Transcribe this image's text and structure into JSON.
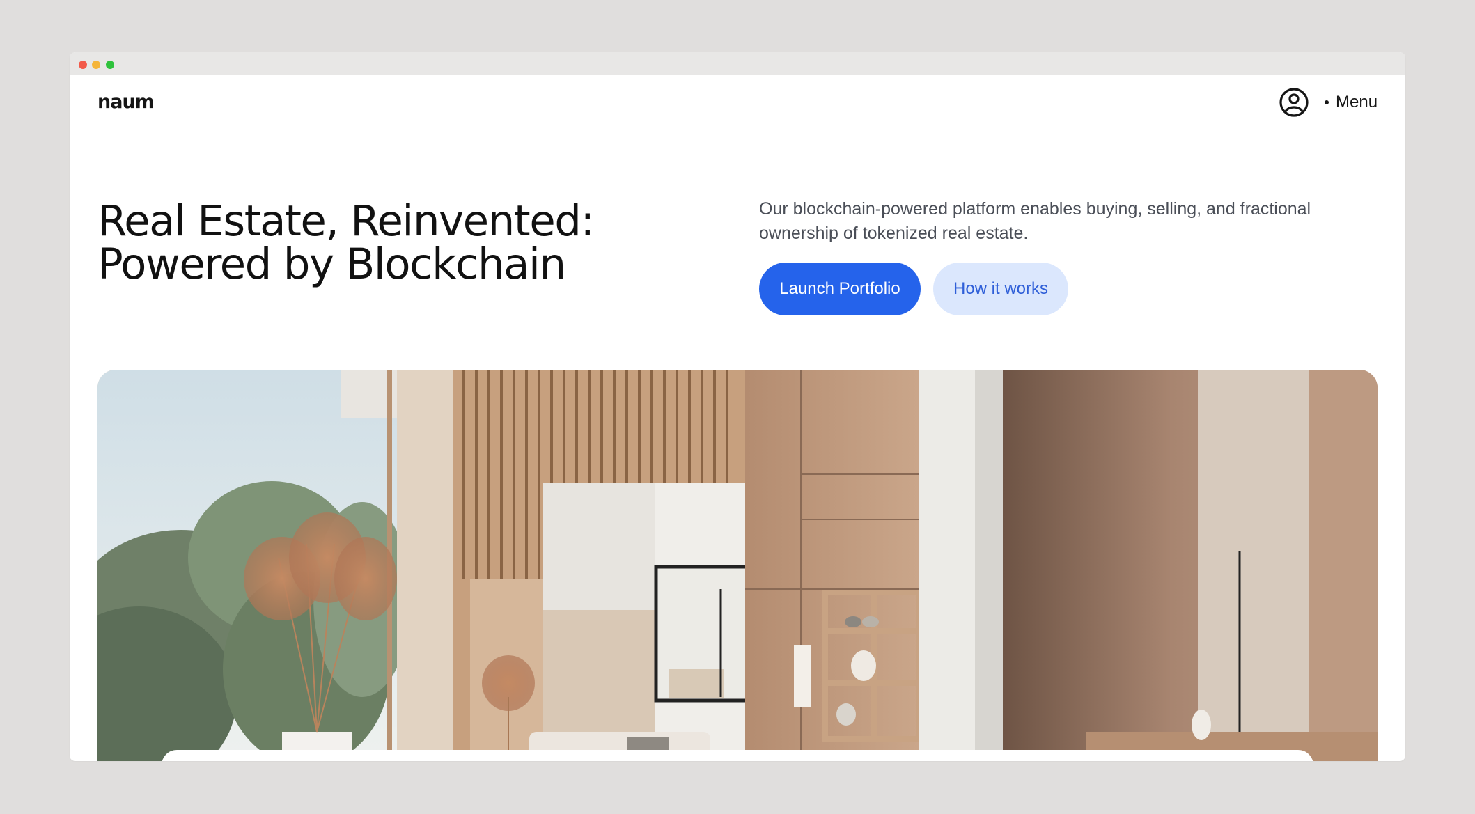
{
  "header": {
    "logo_text": "naum",
    "account_icon": "user-circle-icon",
    "menu_label": "Menu"
  },
  "hero": {
    "headline_line1": "Real Estate, Reinvented:",
    "headline_line2": "Powered by Blockchain",
    "description": "Our blockchain-powered platform enables buying, selling, and fractional ownership of tokenized real estate.",
    "primary_button": "Launch Portfolio",
    "secondary_button": "How it works",
    "image_subject": "modern minimalist interior with wood slats, shelves, vases and pampas grass"
  },
  "colors": {
    "accent": "#2563eb",
    "accent_soft": "#dbe7fd",
    "background": "#e0dedd",
    "text": "#111111"
  }
}
